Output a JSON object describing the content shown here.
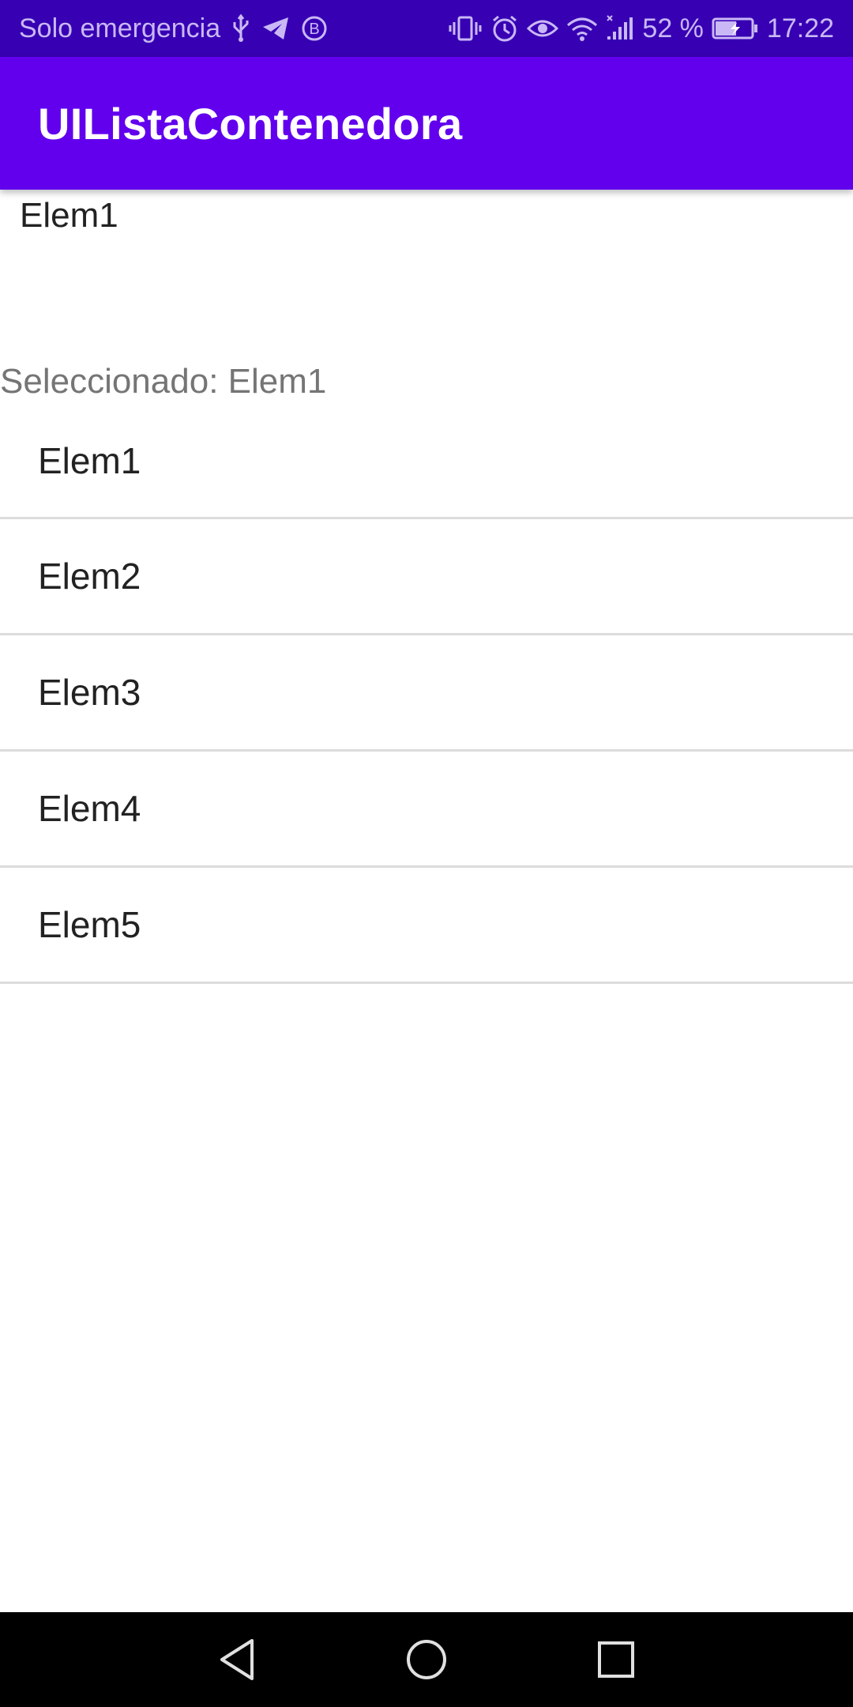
{
  "status_bar": {
    "carrier_text": "Solo emergencia",
    "battery_percent": "52 %",
    "time": "17:22",
    "icons_left": [
      "usb-icon",
      "telegram-icon",
      "b-circle-icon"
    ],
    "icons_right": [
      "vibrate-icon",
      "alarm-icon",
      "eye-icon",
      "wifi-icon",
      "signal-icon",
      "battery-icon"
    ],
    "color_background": "#3700b3"
  },
  "app_bar": {
    "title": "UIListaContenedora",
    "color_background": "#6200ee"
  },
  "spinner": {
    "value": "Elem1"
  },
  "selection": {
    "label": "Seleccionado: Elem1"
  },
  "list": {
    "items": [
      {
        "label": "Elem1"
      },
      {
        "label": "Elem2"
      },
      {
        "label": "Elem3"
      },
      {
        "label": "Elem4"
      },
      {
        "label": "Elem5"
      }
    ]
  },
  "nav_bar": {
    "buttons": [
      "back-icon",
      "home-icon",
      "recents-icon"
    ]
  }
}
